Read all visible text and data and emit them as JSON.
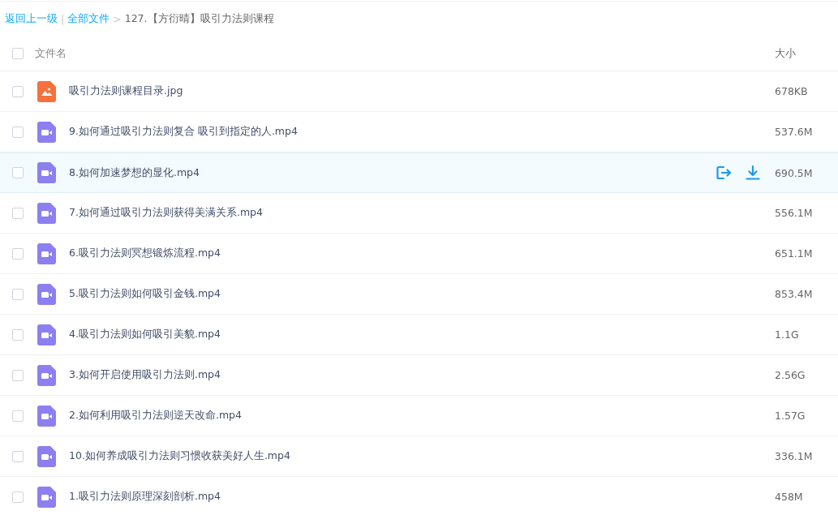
{
  "breadcrumb": {
    "back": "返回上一级",
    "separator": "|",
    "root": "全部文件",
    "arrow": ">",
    "current": "127.【方衍晴】吸引力法则课程"
  },
  "table": {
    "select_all_checked": false,
    "columns": [
      "文件名",
      "大小"
    ],
    "rows": [
      {
        "kind": "image",
        "name": "吸引力法则课程目录.jpg",
        "size": "678KB",
        "checked": false,
        "hovered": false
      },
      {
        "kind": "video",
        "name": "9.如何通过吸引力法则复合 吸引到指定的人.mp4",
        "size": "537.6M",
        "checked": false,
        "hovered": false
      },
      {
        "kind": "video",
        "name": "8.如何加速梦想的显化.mp4",
        "size": "690.5M",
        "checked": false,
        "hovered": true
      },
      {
        "kind": "video",
        "name": "7.如何通过吸引力法则获得美满关系.mp4",
        "size": "556.1M",
        "checked": false,
        "hovered": false
      },
      {
        "kind": "video",
        "name": "6.吸引力法则冥想锻炼流程.mp4",
        "size": "651.1M",
        "checked": false,
        "hovered": false
      },
      {
        "kind": "video",
        "name": "5.吸引力法则如何吸引金钱.mp4",
        "size": "853.4M",
        "checked": false,
        "hovered": false
      },
      {
        "kind": "video",
        "name": "4.吸引力法则如何吸引美貌.mp4",
        "size": "1.1G",
        "checked": false,
        "hovered": false
      },
      {
        "kind": "video",
        "name": "3.如何开启使用吸引力法则.mp4",
        "size": "2.56G",
        "checked": false,
        "hovered": false
      },
      {
        "kind": "video",
        "name": "2.如何利用吸引力法则逆天改命.mp4",
        "size": "1.57G",
        "checked": false,
        "hovered": false
      },
      {
        "kind": "video",
        "name": "10.如何养成吸引力法则习惯收获美好人生.mp4",
        "size": "336.1M",
        "checked": false,
        "hovered": false
      },
      {
        "kind": "video",
        "name": "1.吸引力法则原理深刻剖析.mp4",
        "size": "458M",
        "checked": false,
        "hovered": false
      }
    ]
  }
}
